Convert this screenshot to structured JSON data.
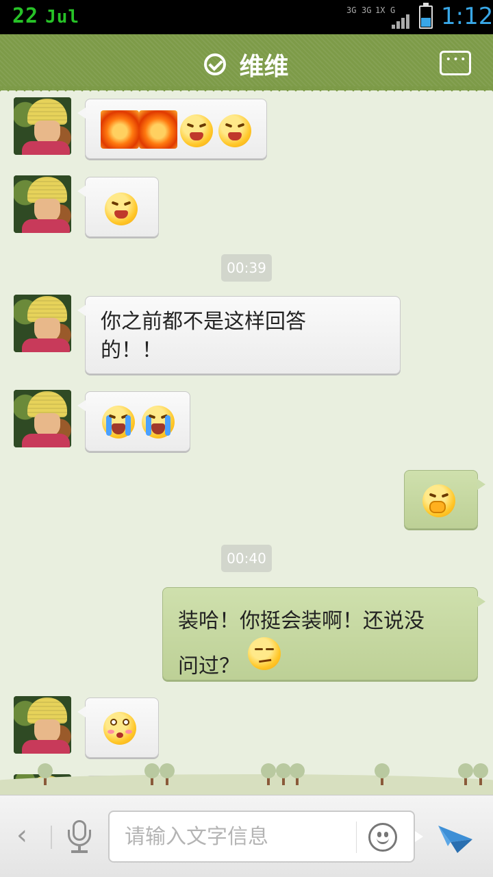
{
  "status_bar": {
    "date_day": "22",
    "date_month": "Jul",
    "network_1": "3G",
    "network_2": "3G",
    "network_3": "1X",
    "network_4": "G",
    "time": "1:12",
    "battery_level_percent": 45
  },
  "header": {
    "title": "维维",
    "verified_icon": "check-circle-icon",
    "menu_icon": "more-dots-icon"
  },
  "messages": [
    {
      "side": "left",
      "type": "emoji",
      "emojis": [
        "angry-fire",
        "angry-fire",
        "grimace",
        "grimace"
      ]
    },
    {
      "side": "left",
      "type": "emoji",
      "emojis": [
        "grimace"
      ]
    },
    {
      "type": "time",
      "text": "00:39"
    },
    {
      "side": "left",
      "type": "text",
      "text": "你之前都不是这样回答\n的！！"
    },
    {
      "side": "left",
      "type": "emoji",
      "emojis": [
        "crying",
        "crying"
      ]
    },
    {
      "side": "right",
      "type": "emoji",
      "emojis": [
        "cover-mouth"
      ]
    },
    {
      "type": "time",
      "text": "00:40"
    },
    {
      "side": "right",
      "type": "text",
      "text": "装哈！你挺会装啊！还说没\n问过？",
      "trailing_emoji": "smug"
    },
    {
      "side": "left",
      "type": "emoji",
      "emojis": [
        "pouting"
      ]
    }
  ],
  "input_bar": {
    "placeholder": "请输入文字信息",
    "value": "",
    "back_icon": "chevron-left-icon",
    "mic_icon": "microphone-icon",
    "emoji_icon": "smiley-icon",
    "send_icon": "paper-plane-icon"
  },
  "colors": {
    "header": "#7d9b48",
    "background": "#e9efdf",
    "self_bubble": "#c8d9a6",
    "other_bubble": "#f2f2f2",
    "clock": "#39a8e8"
  }
}
